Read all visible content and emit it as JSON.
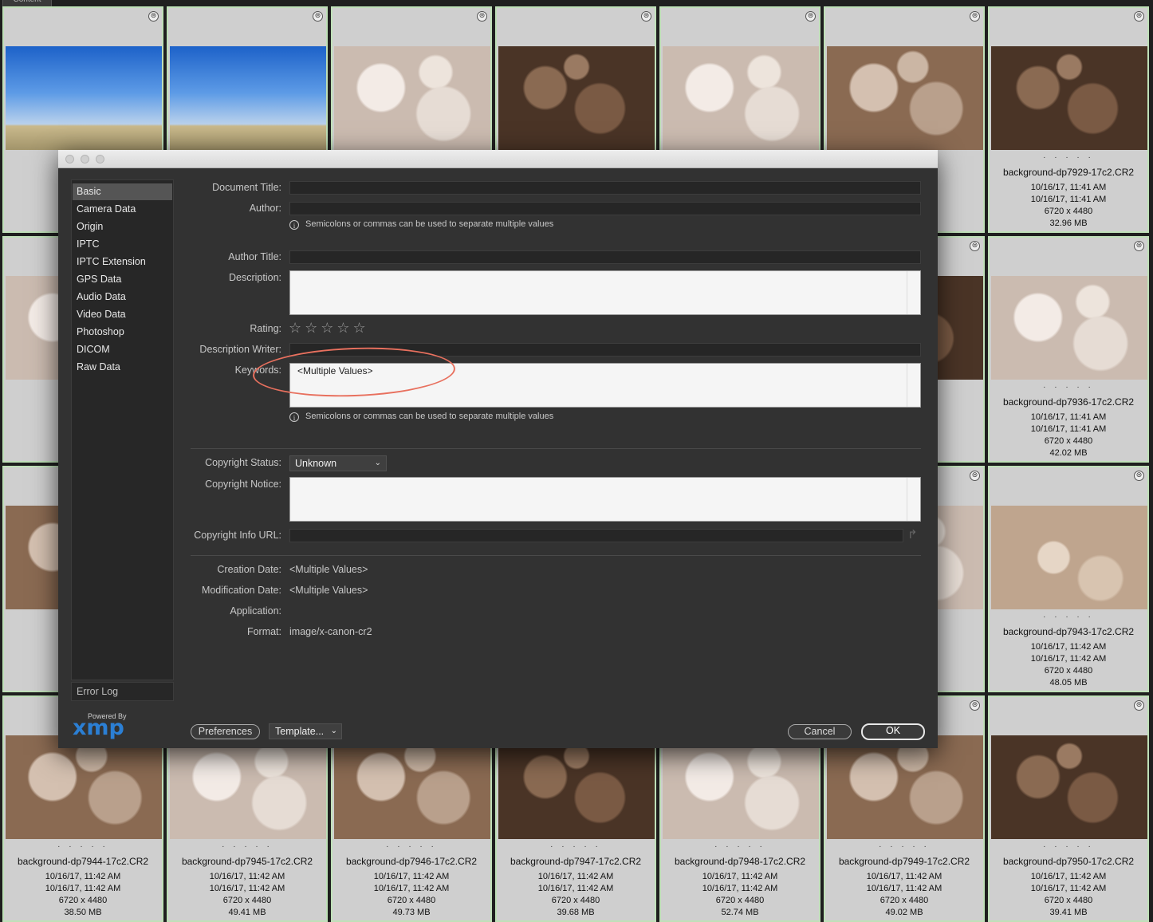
{
  "content_tab": "Content",
  "thumbnails": [
    {
      "kind": "sky",
      "dots": "",
      "name": "",
      "d1": "",
      "d2": "",
      "dims": "",
      "size": ""
    },
    {
      "kind": "sky",
      "dots": "",
      "name": "",
      "d1": "",
      "d2": "",
      "dims": "",
      "size": ""
    },
    {
      "kind": "pale",
      "dots": "",
      "name": "",
      "d1": "",
      "d2": "",
      "dims": "",
      "size": ""
    },
    {
      "kind": "dark",
      "dots": "",
      "name": "",
      "d1": "",
      "d2": "",
      "dims": "",
      "size": ""
    },
    {
      "kind": "pale",
      "dots": "",
      "name": "",
      "d1": "",
      "d2": "",
      "dims": "",
      "size": ""
    },
    {
      "kind": "mid",
      "dots": "",
      "name": "7c2.CR2",
      "d1": "M",
      "d2": "M",
      "dims": "",
      "size": ""
    },
    {
      "kind": "dark",
      "dots": "· · · · ·",
      "name": "background-dp7929-17c2.CR2",
      "d1": "10/16/17, 11:41 AM",
      "d2": "10/16/17, 11:41 AM",
      "dims": "6720 x 4480",
      "size": "32.96 MB"
    },
    {
      "kind": "pale",
      "dots": "",
      "name": "backgrou",
      "d1": "10/",
      "d2": "10/",
      "dims": "",
      "size": ""
    },
    {
      "kind": "pale",
      "dots": "",
      "name": "",
      "d1": "",
      "d2": "",
      "dims": "",
      "size": ""
    },
    {
      "kind": "pale",
      "dots": "",
      "name": "",
      "d1": "",
      "d2": "",
      "dims": "",
      "size": ""
    },
    {
      "kind": "pale",
      "dots": "",
      "name": "",
      "d1": "",
      "d2": "",
      "dims": "",
      "size": ""
    },
    {
      "kind": "pale",
      "dots": "",
      "name": "",
      "d1": "",
      "d2": "",
      "dims": "",
      "size": ""
    },
    {
      "kind": "dark",
      "dots": "",
      "name": "7c2.CR2",
      "d1": "M",
      "d2": "M",
      "dims": "",
      "size": ""
    },
    {
      "kind": "pale",
      "dots": "· · · · ·",
      "name": "background-dp7936-17c2.CR2",
      "d1": "10/16/17, 11:41 AM",
      "d2": "10/16/17, 11:41 AM",
      "dims": "6720 x 4480",
      "size": "42.02 MB"
    },
    {
      "kind": "mid",
      "dots": "",
      "name": "backgrou",
      "d1": "10/",
      "d2": "10/",
      "dims": "",
      "size": ""
    },
    {
      "kind": "pale",
      "dots": "",
      "name": "",
      "d1": "",
      "d2": "",
      "dims": "",
      "size": ""
    },
    {
      "kind": "pale",
      "dots": "",
      "name": "",
      "d1": "",
      "d2": "",
      "dims": "",
      "size": ""
    },
    {
      "kind": "pale",
      "dots": "",
      "name": "",
      "d1": "",
      "d2": "",
      "dims": "",
      "size": ""
    },
    {
      "kind": "pale",
      "dots": "",
      "name": "",
      "d1": "",
      "d2": "",
      "dims": "",
      "size": ""
    },
    {
      "kind": "pale",
      "dots": "",
      "name": "7c2.CR2",
      "d1": "M",
      "d2": "M",
      "dims": "",
      "size": ""
    },
    {
      "kind": "sandy",
      "dots": "· · · · ·",
      "name": "background-dp7943-17c2.CR2",
      "d1": "10/16/17, 11:42 AM",
      "d2": "10/16/17, 11:42 AM",
      "dims": "6720 x 4480",
      "size": "48.05 MB"
    },
    {
      "kind": "mid",
      "dots": "· · · · ·",
      "name": "background-dp7944-17c2.CR2",
      "d1": "10/16/17, 11:42 AM",
      "d2": "10/16/17, 11:42 AM",
      "dims": "6720 x 4480",
      "size": "38.50 MB"
    },
    {
      "kind": "pale",
      "dots": "· · · · ·",
      "name": "background-dp7945-17c2.CR2",
      "d1": "10/16/17, 11:42 AM",
      "d2": "10/16/17, 11:42 AM",
      "dims": "6720 x 4480",
      "size": "49.41 MB"
    },
    {
      "kind": "mid",
      "dots": "· · · · ·",
      "name": "background-dp7946-17c2.CR2",
      "d1": "10/16/17, 11:42 AM",
      "d2": "10/16/17, 11:42 AM",
      "dims": "6720 x 4480",
      "size": "49.73 MB"
    },
    {
      "kind": "dark",
      "dots": "· · · · ·",
      "name": "background-dp7947-17c2.CR2",
      "d1": "10/16/17, 11:42 AM",
      "d2": "10/16/17, 11:42 AM",
      "dims": "6720 x 4480",
      "size": "39.68 MB"
    },
    {
      "kind": "pale",
      "dots": "· · · · ·",
      "name": "background-dp7948-17c2.CR2",
      "d1": "10/16/17, 11:42 AM",
      "d2": "10/16/17, 11:42 AM",
      "dims": "6720 x 4480",
      "size": "52.74 MB"
    },
    {
      "kind": "mid",
      "dots": "· · · · ·",
      "name": "background-dp7949-17c2.CR2",
      "d1": "10/16/17, 11:42 AM",
      "d2": "10/16/17, 11:42 AM",
      "dims": "6720 x 4480",
      "size": "49.02 MB"
    },
    {
      "kind": "dark",
      "dots": "· · · · ·",
      "name": "background-dp7950-17c2.CR2",
      "d1": "10/16/17, 11:42 AM",
      "d2": "10/16/17, 11:42 AM",
      "dims": "6720 x 4480",
      "size": "39.41 MB"
    }
  ],
  "dialog": {
    "sidebar": [
      "Basic",
      "Camera Data",
      "Origin",
      "IPTC",
      "IPTC Extension",
      "GPS Data",
      "Audio Data",
      "Video Data",
      "Photoshop",
      "DICOM",
      "Raw Data"
    ],
    "selected_index": 0,
    "error_log": "Error Log",
    "powered_by": "Powered By",
    "xmp_logo": "xmp",
    "labels": {
      "document_title": "Document Title:",
      "author": "Author:",
      "author_title": "Author Title:",
      "description": "Description:",
      "rating": "Rating:",
      "description_writer": "Description Writer:",
      "keywords": "Keywords:",
      "copyright_status": "Copyright Status:",
      "copyright_notice": "Copyright Notice:",
      "copyright_info_url": "Copyright Info URL:",
      "creation_date": "Creation Date:",
      "modification_date": "Modification Date:",
      "application": "Application:",
      "format": "Format:"
    },
    "hint_text": "Semicolons or commas can be used to separate multiple values",
    "hint_icon": "i",
    "rating_stars": "☆☆☆☆☆",
    "rating_value": 0,
    "keywords_value": "<Multiple Values>",
    "copyright_status_value": "Unknown",
    "creation_date_value": "<Multiple Values>",
    "modification_date_value": "<Multiple Values>",
    "application_value": "",
    "format_value": "image/x-canon-cr2",
    "buttons": {
      "preferences": "Preferences",
      "template": "Template...",
      "cancel": "Cancel",
      "ok": "OK"
    },
    "callout_color": "#e8705e"
  }
}
